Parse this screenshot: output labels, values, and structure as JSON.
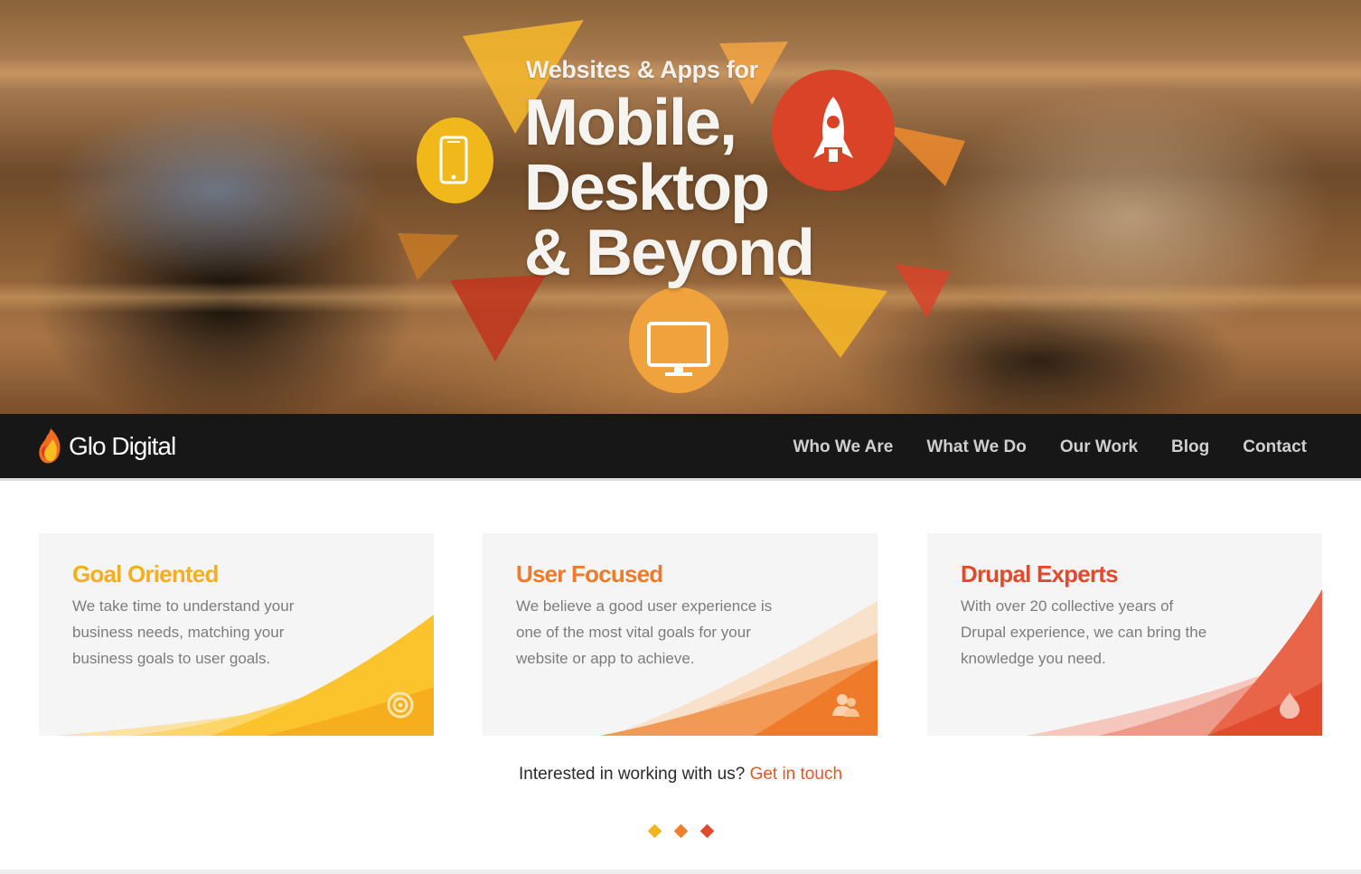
{
  "hero": {
    "subtitle": "Websites & Apps for",
    "title_line1": "Mobile,",
    "title_line2": "Desktop",
    "title_line3": "& Beyond",
    "icons": [
      "mobile-phone-icon",
      "rocket-icon",
      "desktop-monitor-icon"
    ]
  },
  "nav": {
    "brand": "Glo Digital",
    "links": [
      "Who We Are",
      "What We Do",
      "Our Work",
      "Blog",
      "Contact"
    ]
  },
  "features": [
    {
      "title": "Goal Oriented",
      "text": "We take time to understand your business needs, matching your business goals to user goals.",
      "color": "#f7ae1e",
      "icon": "target-icon"
    },
    {
      "title": "User Focused",
      "text": "We believe a good user experience is one of the most vital goals for your website or app to achieve.",
      "color": "#ee7a2a",
      "icon": "users-icon"
    },
    {
      "title": "Drupal Experts",
      "text": "With over 20 collective years of Drupal experience, we can bring the knowledge you need.",
      "color": "#e14a2d",
      "icon": "drupal-drop-icon"
    }
  ],
  "cta": {
    "question": "Interested in working with us?",
    "link": "Get in touch"
  },
  "colors": {
    "yellow": "#f6b21e",
    "orange": "#ee7a2a",
    "red": "#e14a2d",
    "nav_bg": "#171717"
  }
}
